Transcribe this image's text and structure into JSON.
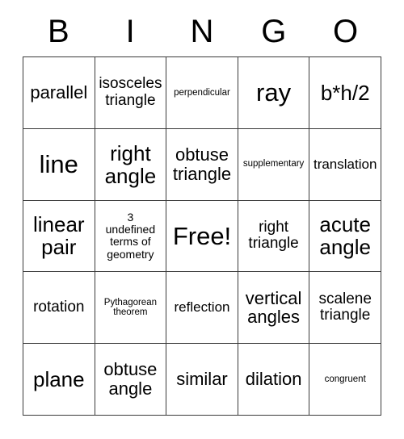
{
  "card": {
    "title": "BINGO",
    "header_letters": [
      "B",
      "I",
      "N",
      "G",
      "O"
    ],
    "grid_size": "5x5",
    "free_space_label": "Free!",
    "colors": {
      "background": "#ffffff",
      "text": "#000000",
      "border": "#3a3a3a"
    },
    "rows": [
      [
        {
          "text": "parallel",
          "size": "lg"
        },
        {
          "text": "isosceles\ntriangle",
          "size": "md"
        },
        {
          "text": "perpendicular",
          "size": "xxs"
        },
        {
          "text": "ray",
          "size": "xxl"
        },
        {
          "text": "b*h/2",
          "size": "xl"
        }
      ],
      [
        {
          "text": "line",
          "size": "xxl"
        },
        {
          "text": "right\nangle",
          "size": "xl"
        },
        {
          "text": "obtuse\ntriangle",
          "size": "lg"
        },
        {
          "text": "supplementary",
          "size": "xxs"
        },
        {
          "text": "translation",
          "size": "sm"
        }
      ],
      [
        {
          "text": "linear\npair",
          "size": "xl"
        },
        {
          "text": "3\nundefined\nterms of\ngeometry",
          "size": "xs"
        },
        {
          "text": "Free!",
          "size": "xxl"
        },
        {
          "text": "right\ntriangle",
          "size": "md"
        },
        {
          "text": "acute\nangle",
          "size": "xl"
        }
      ],
      [
        {
          "text": "rotation",
          "size": "md"
        },
        {
          "text": "Pythagorean\ntheorem",
          "size": "xxs"
        },
        {
          "text": "reflection",
          "size": "sm"
        },
        {
          "text": "vertical\nangles",
          "size": "lg"
        },
        {
          "text": "scalene\ntriangle",
          "size": "md"
        }
      ],
      [
        {
          "text": "plane",
          "size": "xl"
        },
        {
          "text": "obtuse\nangle",
          "size": "lg"
        },
        {
          "text": "similar",
          "size": "lg"
        },
        {
          "text": "dilation",
          "size": "lg"
        },
        {
          "text": "congruent",
          "size": "xxs"
        }
      ]
    ]
  }
}
